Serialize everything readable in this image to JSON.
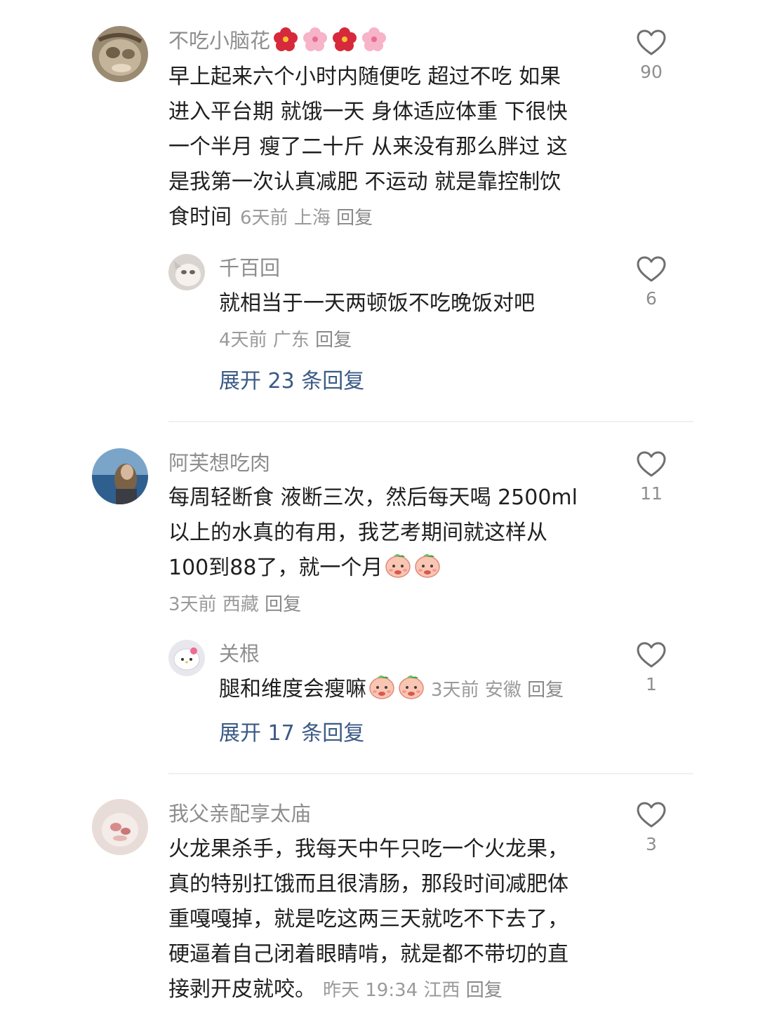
{
  "comments": [
    {
      "username": "不吃小脑花🌺🌸🌺🌸",
      "username_text": "不吃小脑花",
      "lines": [
        "早上起来六个小时内随便吃 超过不吃 如果",
        "进入平台期 就饿一天 身体适应体重 下很快",
        "一个半月 瘦了二十斤 从来没有那么胖过 这",
        "是我第一次认真减肥 不运动 就是靠控制饮"
      ],
      "last_line": "食时间",
      "time": "6天前",
      "location": "上海",
      "reply_label": "回复",
      "likes": "90",
      "replies": [
        {
          "username": "千百回",
          "text": "就相当于一天两顿饭不吃晚饭对吧",
          "time": "4天前",
          "location": "广东",
          "reply_label": "回复",
          "likes": "6"
        }
      ],
      "expand_label": "展开 23 条回复"
    },
    {
      "username": "阿芙想吃肉",
      "lines": [
        "每周轻断食 液断三次，然后每天喝 2500ml",
        "以上的水真的有用，我艺考期间就这样从"
      ],
      "last_line": "100到88了，就一个月",
      "time": "3天前",
      "location": "西藏",
      "reply_label": "回复",
      "likes": "11",
      "replies": [
        {
          "username": "关根",
          "text": "腿和维度会瘦嘛",
          "time": "3天前",
          "location": "安徽",
          "reply_label": "回复",
          "likes": "1"
        }
      ],
      "expand_label": "展开 17 条回复"
    },
    {
      "username": "我父亲配享太庙",
      "lines": [
        "火龙果杀手，我每天中午只吃一个火龙果，",
        "真的特别扛饿而且很清肠，那段时间减肥体",
        "重嘎嘎掉，就是吃这两三天就吃不下去了，",
        "硬逼着自己闭着眼睛啃，就是都不带切的直"
      ],
      "last_line": "接剥开皮就咬。",
      "time": "昨天 19:34",
      "location": "江西",
      "reply_label": "回复",
      "likes": "3"
    }
  ],
  "colors": {
    "username": "#8e8e8e",
    "body": "#1f1f1f",
    "meta": "#9a9a9a",
    "expand": "#3a5a85",
    "divider": "#f0f0f0"
  },
  "icons": {
    "like": "heart-outline-icon",
    "flower": "hibiscus-emoji",
    "blossom": "cherry-blossom-emoji",
    "peach": "peach-face-emoji"
  }
}
